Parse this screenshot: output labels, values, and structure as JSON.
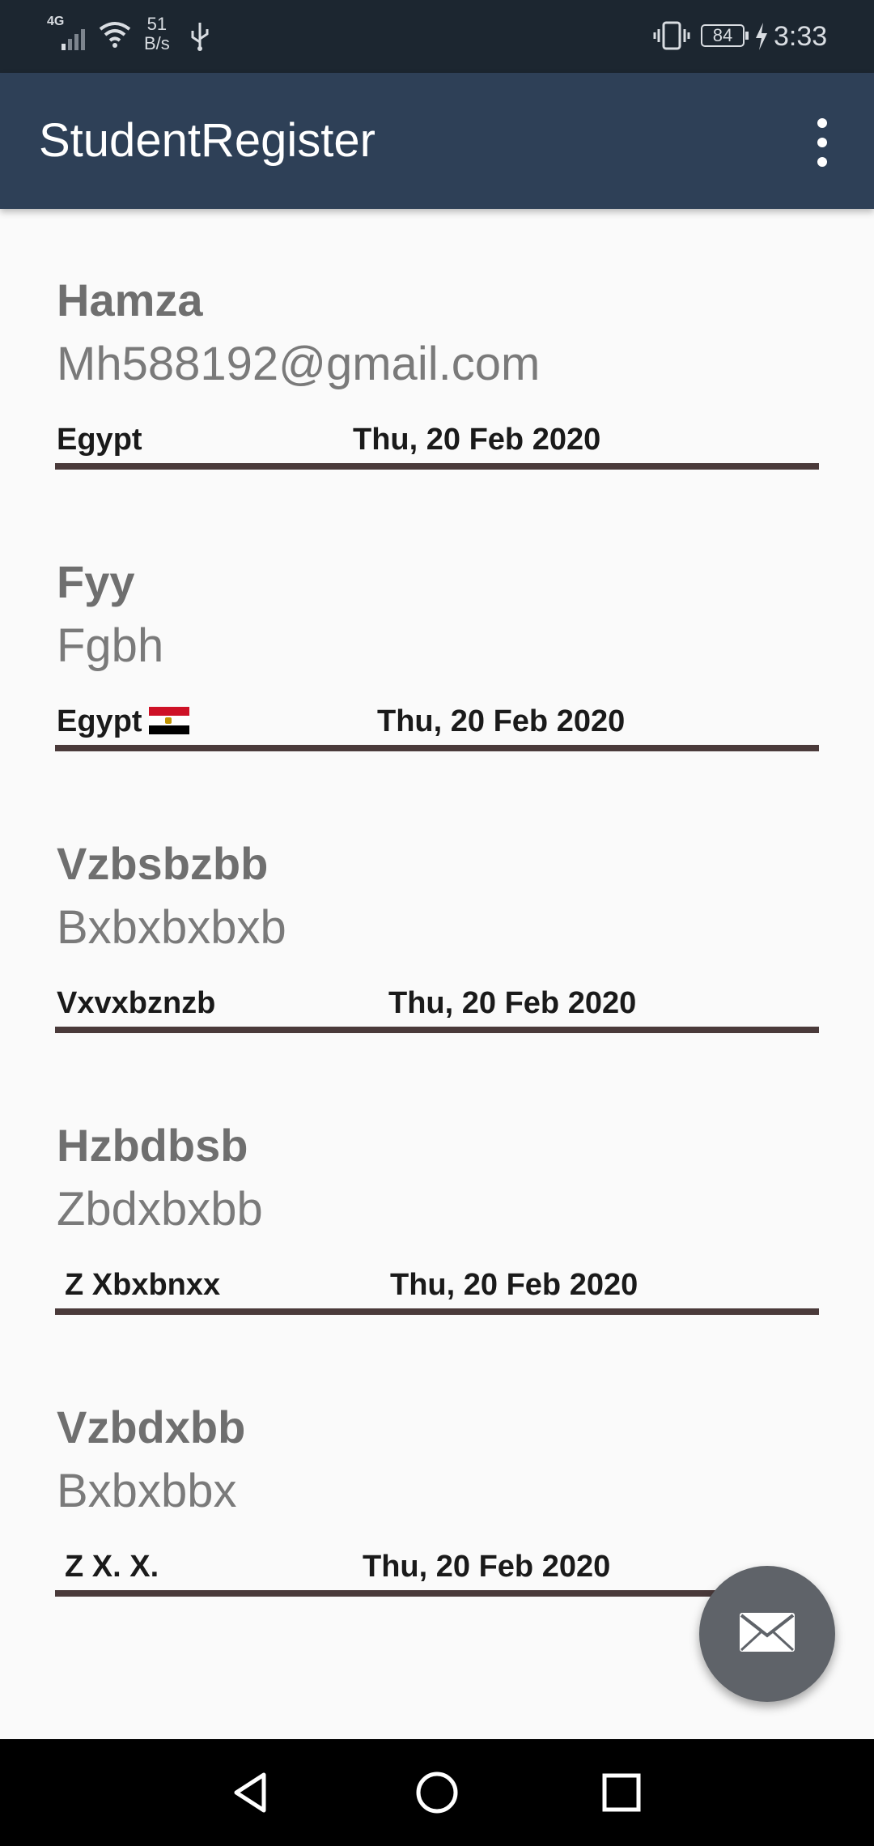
{
  "status_bar": {
    "network": "4G",
    "speed_value": "51",
    "speed_unit": "B/s",
    "battery": "84",
    "time": "3:33",
    "icons": [
      "signal-icon",
      "wifi-icon",
      "usb-icon",
      "vibrate-icon",
      "battery-icon",
      "charging-icon"
    ]
  },
  "app_bar": {
    "title": "StudentRegister",
    "menu_icon": "more-vert-icon"
  },
  "students": [
    {
      "name": "Hamza",
      "email": "Mh588192@gmail.com",
      "country": "Egypt",
      "flag": false,
      "date": "Thu, 20 Feb 2020"
    },
    {
      "name": "Fyy",
      "email": "Fgbh",
      "country": "Egypt",
      "flag": true,
      "date": "Thu, 20 Feb 2020"
    },
    {
      "name": "Vzbsbzbb",
      "email": "Bxbxbxbxb",
      "country": "Vxvxbznzb",
      "flag": false,
      "date": "Thu, 20 Feb 2020"
    },
    {
      "name": "Hzbdbsb",
      "email": "Zbdxbxbb",
      "country": "Z Xbxbnxx",
      "flag": false,
      "date": "Thu, 20 Feb 2020"
    },
    {
      "name": "Vzbdxbb",
      "email": "Bxbxbbx",
      "country": "Z X. X.",
      "flag": false,
      "date": "Thu, 20 Feb 2020"
    }
  ],
  "fab": {
    "icon": "mail-icon"
  },
  "nav_bar": {
    "icons": [
      "back-icon",
      "home-icon",
      "recents-icon"
    ]
  },
  "colors": {
    "status_bar": "#1c2630",
    "app_bar": "#2e4057",
    "divider": "#4a3a3a",
    "fab": "#5f6369",
    "background": "#fafafa"
  }
}
